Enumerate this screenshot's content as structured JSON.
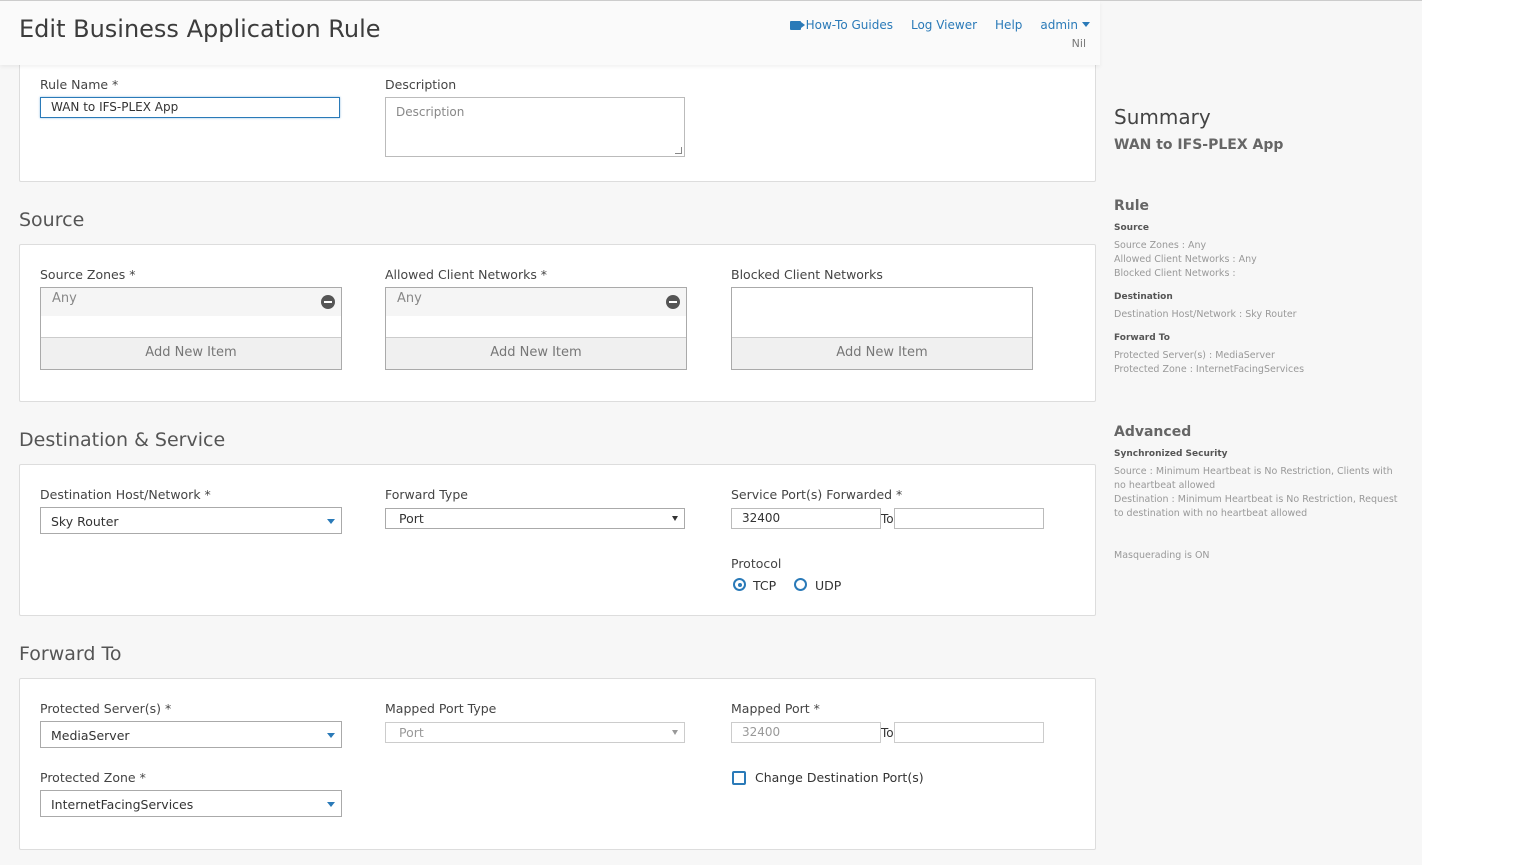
{
  "header": {
    "title": "Edit Business Application Rule",
    "links": {
      "how_to": "How-To Guides",
      "log_viewer": "Log Viewer",
      "help": "Help",
      "user": "admin"
    },
    "sub_user": "Nil"
  },
  "general": {
    "rule_name_label": "Rule Name *",
    "rule_name_value": "WAN to IFS-PLEX App",
    "description_label": "Description",
    "description_placeholder": "Description"
  },
  "source": {
    "title": "Source",
    "zones_label": "Source Zones *",
    "zones_items": [
      "Any"
    ],
    "allowed_label": "Allowed Client Networks *",
    "allowed_items": [
      "Any"
    ],
    "blocked_label": "Blocked Client Networks",
    "add_new_label": "Add New Item"
  },
  "destination": {
    "title": "Destination & Service",
    "host_label": "Destination Host/Network *",
    "host_value": "Sky Router",
    "forward_type_label": "Forward Type",
    "forward_type_value": "Port",
    "service_port_label": "Service Port(s) Forwarded *",
    "service_port_value": "32400",
    "to_label": "To",
    "protocol_label": "Protocol",
    "protocol_tcp": "TCP",
    "protocol_udp": "UDP",
    "protocol_selected": "TCP"
  },
  "forward_to": {
    "title": "Forward To",
    "servers_label": "Protected Server(s) *",
    "servers_value": "MediaServer",
    "mapped_type_label": "Mapped Port Type",
    "mapped_type_value": "Port",
    "mapped_port_label": "Mapped Port *",
    "mapped_port_value": "32400",
    "to_label": "To",
    "zone_label": "Protected Zone *",
    "zone_value": "InternetFacingServices",
    "change_dest_label": "Change Destination Port(s)"
  },
  "summary": {
    "title": "Summary",
    "rule_name": "WAN to IFS-PLEX App",
    "rule_heading": "Rule",
    "source_heading": "Source",
    "source_lines": [
      "Source Zones : Any",
      "Allowed Client Networks : Any",
      "Blocked Client Networks :"
    ],
    "destination_heading": "Destination",
    "destination_lines": [
      "Destination Host/Network : Sky Router"
    ],
    "forward_heading": "Forward To",
    "forward_lines": [
      "Protected Server(s) : MediaServer",
      "Protected Zone : InternetFacingServices"
    ],
    "advanced_heading": "Advanced",
    "sync_heading": "Synchronized Security",
    "sync_source": "Source : Minimum Heartbeat is No Restriction, Clients with no heartbeat allowed",
    "sync_destination": "Destination : Minimum Heartbeat is No Restriction, Request to destination with no heartbeat allowed",
    "masquerading": "Masquerading is ON"
  },
  "colors": {
    "accent": "#2a7ab8",
    "panel_bg": "#ffffff",
    "page_bg": "#f7f7f7"
  }
}
